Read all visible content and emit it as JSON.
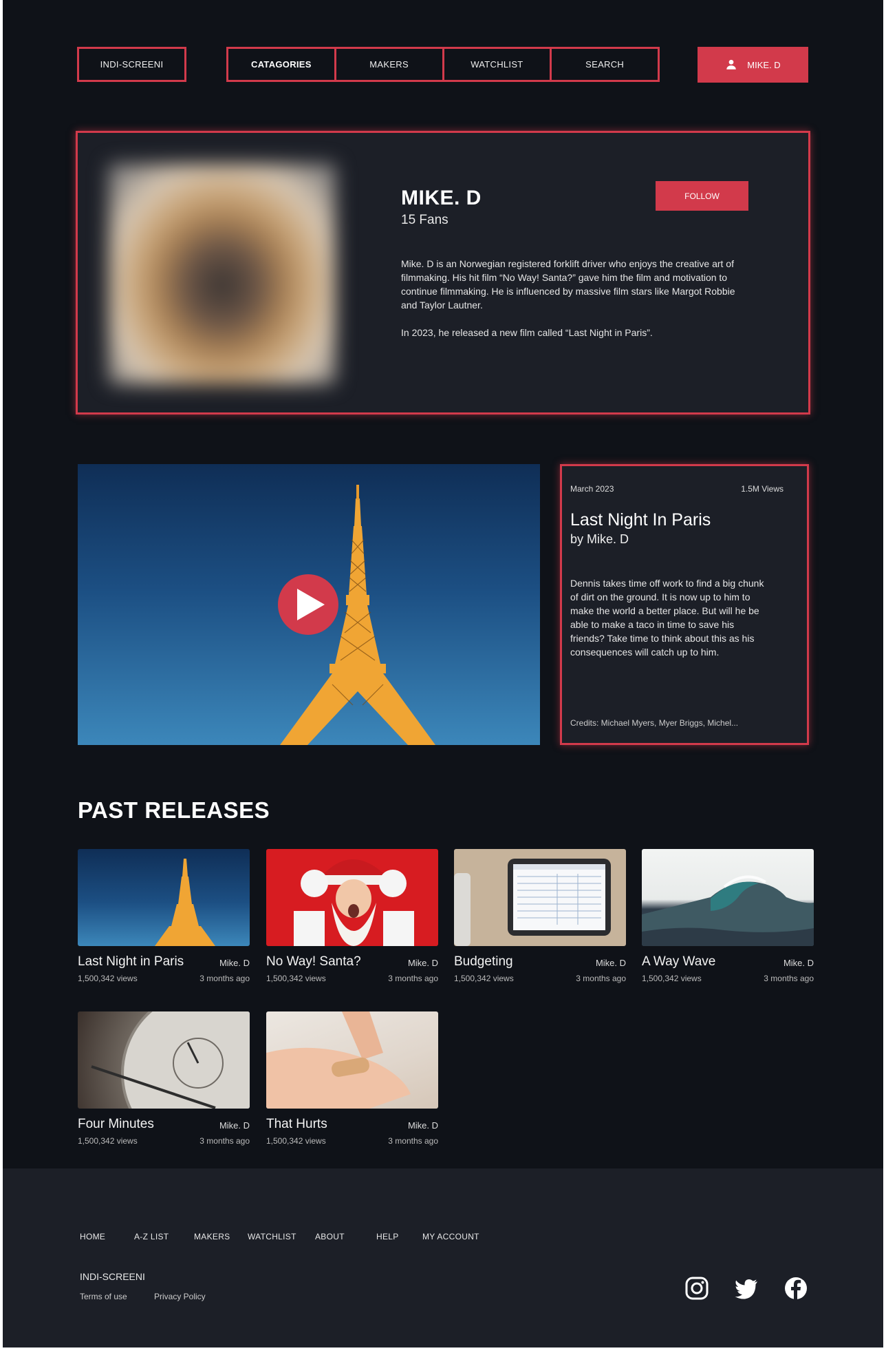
{
  "nav": {
    "logo": "INDI-SCREENI",
    "items": [
      "CATAGORIES",
      "MAKERS",
      "WATCHLIST",
      "SEARCH"
    ],
    "user_label": "MIKE. D",
    "user_icon": "person-icon"
  },
  "profile": {
    "name": "MIKE. D",
    "fans": "15 Fans",
    "follow_label": "FOLLOW",
    "bio_1": "Mike. D is an Norwegian registered forklift driver who enjoys the creative art of filmmaking. His hit film “No Way! Santa?”  gave him the film and motivation to continue filmmaking.  He is influenced by massive film stars like Margot Robbie and Taylor Lautner.",
    "bio_2": "In 2023, he released a new film called “Last Night in Paris”."
  },
  "feature": {
    "date": "March 2023",
    "views": "1.5M Views",
    "title": "Last Night In Paris",
    "by": "by Mike. D",
    "description": "Dennis takes time off work to find a big chunk of dirt on the ground. It is now up to him to make the world a better place. But will he be able to make a taco in time to save his friends? Take time to think about this as his consequences will catch up to him.",
    "credits": "Credits: Michael Myers, Myer Briggs, Michel...",
    "play_icon": "play-icon"
  },
  "past": {
    "title": "PAST RELEASES",
    "items": [
      {
        "title": "Last Night in Paris",
        "maker": "Mike. D",
        "views": "1,500,342 views",
        "ago": "3 months ago"
      },
      {
        "title": "No Way! Santa?",
        "maker": "Mike. D",
        "views": "1,500,342 views",
        "ago": "3 months ago"
      },
      {
        "title": "Budgeting",
        "maker": "Mike. D",
        "views": "1,500,342 views",
        "ago": "3 months ago"
      },
      {
        "title": "A Way Wave",
        "maker": "Mike. D",
        "views": "1,500,342 views",
        "ago": "3 months ago"
      },
      {
        "title": "Four Minutes",
        "maker": "Mike. D",
        "views": "1,500,342 views",
        "ago": "3 months ago"
      },
      {
        "title": "That Hurts",
        "maker": "Mike. D",
        "views": "1,500,342 views",
        "ago": "3 months ago"
      }
    ]
  },
  "footer": {
    "links": [
      "HOME",
      "A-Z LIST",
      "MAKERS",
      "WATCHLIST",
      "ABOUT",
      "HELP",
      "MY ACCOUNT"
    ],
    "brand": "INDI-SCREENI",
    "terms": "Terms of use",
    "privacy": "Privacy Policy",
    "social": [
      "instagram-icon",
      "twitter-icon",
      "facebook-icon"
    ]
  },
  "colors": {
    "accent": "#d23a4b",
    "background": "#0f1218",
    "panel": "#1c1f27"
  }
}
